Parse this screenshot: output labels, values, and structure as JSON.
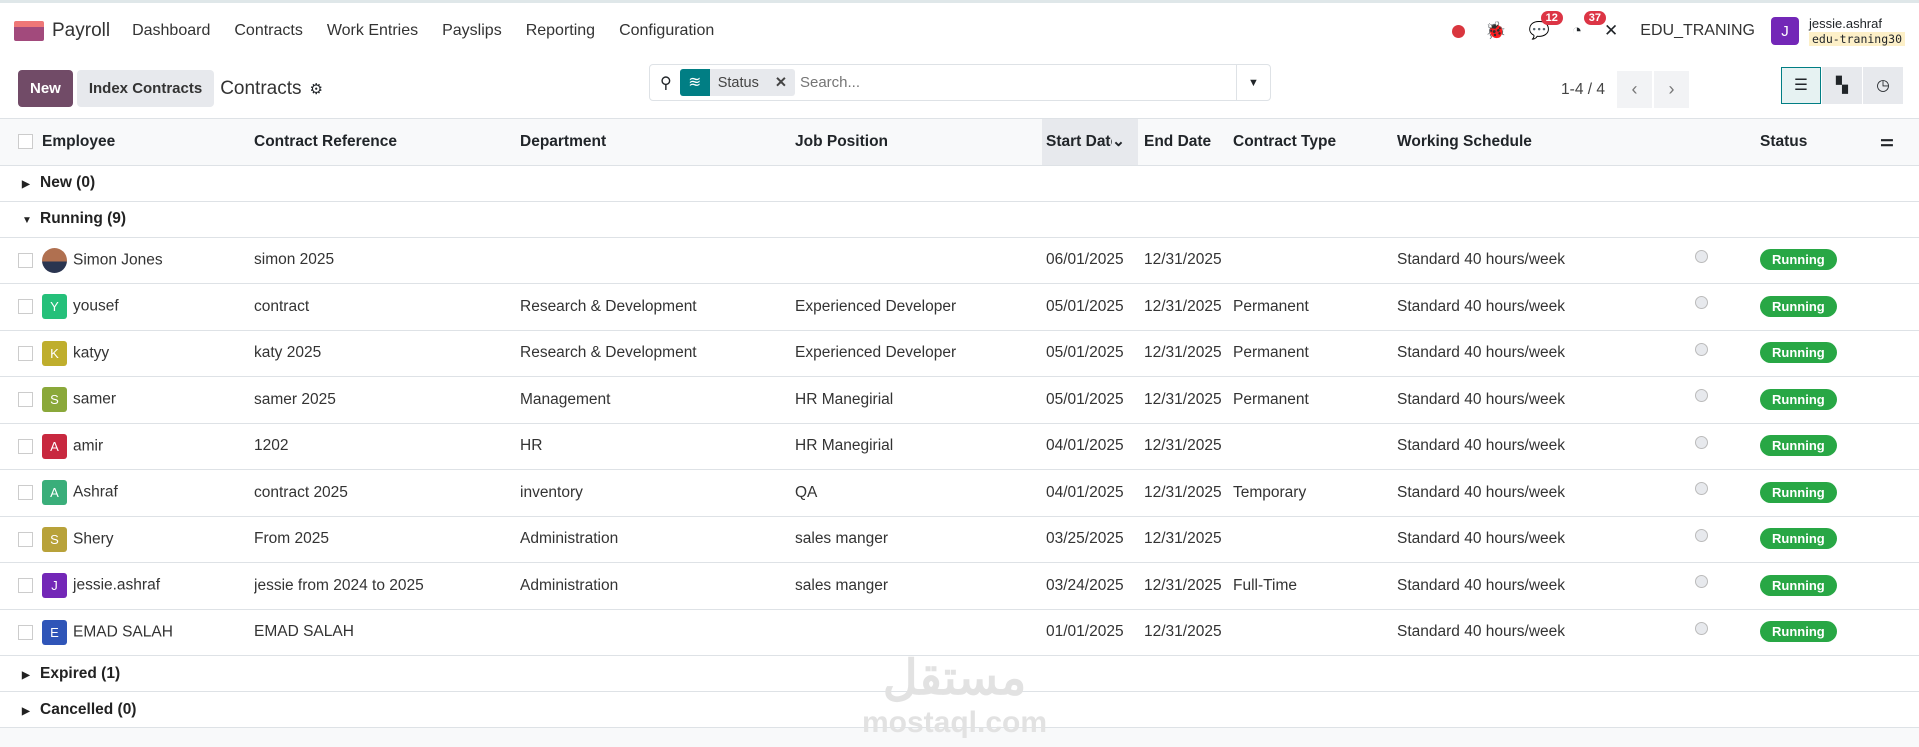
{
  "nav": {
    "app": "Payroll",
    "menu": [
      "Dashboard",
      "Contracts",
      "Work Entries",
      "Payslips",
      "Reporting",
      "Configuration"
    ],
    "messages_count": "12",
    "activities_count": "37",
    "company": "EDU_TRANING",
    "user_initial": "J",
    "user": "jessie.ashraf",
    "database": "edu-traning30"
  },
  "control": {
    "new": "New",
    "index": "Index Contracts",
    "title": "Contracts",
    "facet": "Status",
    "search_placeholder": "Search...",
    "pager": "1-4 / 4"
  },
  "columns": [
    "Employee",
    "Contract Reference",
    "Department",
    "Job Position",
    "Start Date",
    "End Date",
    "Contract Type",
    "Working Schedule",
    "Status"
  ],
  "groups": {
    "new": "New (0)",
    "running": "Running (9)",
    "expired": "Expired (1)",
    "cancelled": "Cancelled (0)"
  },
  "rows": [
    {
      "initial": "",
      "color": "#8a5a44",
      "employee": "Simon Jones",
      "ref": "simon 2025",
      "dept": "",
      "job": "",
      "start": "06/01/2025",
      "end": "12/31/2025",
      "type": "",
      "schedule": "Standard 40 hours/week",
      "status": "Running"
    },
    {
      "initial": "Y",
      "color": "#25c07a",
      "employee": "yousef",
      "ref": "contract",
      "dept": "Research & Development",
      "job": "Experienced Developer",
      "start": "05/01/2025",
      "end": "12/31/2025",
      "type": "Permanent",
      "schedule": "Standard 40 hours/week",
      "status": "Running"
    },
    {
      "initial": "K",
      "color": "#bfae2d",
      "employee": "katyy",
      "ref": "katy 2025",
      "dept": "Research & Development",
      "job": "Experienced Developer",
      "start": "05/01/2025",
      "end": "12/31/2025",
      "type": "Permanent",
      "schedule": "Standard 40 hours/week",
      "status": "Running"
    },
    {
      "initial": "S",
      "color": "#8aa83a",
      "employee": "samer",
      "ref": "samer 2025",
      "dept": "Management",
      "job": "HR Manegirial",
      "start": "05/01/2025",
      "end": "12/31/2025",
      "type": "Permanent",
      "schedule": "Standard 40 hours/week",
      "status": "Running"
    },
    {
      "initial": "A",
      "color": "#c8283f",
      "employee": "amir",
      "ref": "1202",
      "dept": "HR",
      "job": "HR Manegirial",
      "start": "04/01/2025",
      "end": "12/31/2025",
      "type": "",
      "schedule": "Standard 40 hours/week",
      "status": "Running"
    },
    {
      "initial": "A",
      "color": "#3aae7a",
      "employee": "Ashraf",
      "ref": "contract 2025",
      "dept": "inventory",
      "job": "QA",
      "start": "04/01/2025",
      "end": "12/31/2025",
      "type": "Temporary",
      "schedule": "Standard 40 hours/week",
      "status": "Running"
    },
    {
      "initial": "S",
      "color": "#b8a23a",
      "employee": "Shery",
      "ref": "From 2025",
      "dept": "Administration",
      "job": "sales manger",
      "start": "03/25/2025",
      "end": "12/31/2025",
      "type": "",
      "schedule": "Standard 40 hours/week",
      "status": "Running"
    },
    {
      "initial": "J",
      "color": "#7327b7",
      "employee": "jessie.ashraf",
      "ref": "jessie from 2024 to 2025",
      "dept": "Administration",
      "job": "sales manger",
      "start": "03/24/2025",
      "end": "12/31/2025",
      "type": "Full-Time",
      "schedule": "Standard 40 hours/week",
      "status": "Running"
    },
    {
      "initial": "E",
      "color": "#2f55b8",
      "employee": "EMAD SALAH",
      "ref": "EMAD SALAH",
      "dept": "",
      "job": "",
      "start": "01/01/2025",
      "end": "12/31/2025",
      "type": "",
      "schedule": "Standard 40 hours/week",
      "status": "Running"
    }
  ],
  "watermark": {
    "arabic": "مستقل",
    "latin": "mostaql.com"
  }
}
